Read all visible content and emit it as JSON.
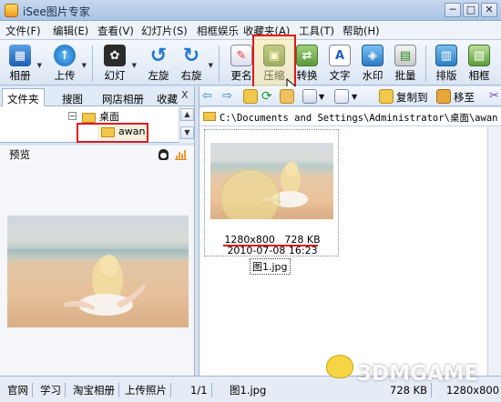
{
  "window": {
    "title": "iSee图片专家",
    "controls": [
      "─",
      "□",
      "✕"
    ]
  },
  "menu": [
    "文件(F)",
    "编辑(E)",
    "查看(V)",
    "幻灯片(S)",
    "相框娱乐",
    "收藏夹(A)",
    "工具(T)",
    "帮助(H)"
  ],
  "toolbar": {
    "album": "相册",
    "upload": "上传",
    "slideshow": "幻灯",
    "rotate_left": "左旋",
    "rotate_right": "右旋",
    "rename": "更名",
    "compress": "压缩",
    "convert": "转换",
    "text": "文字",
    "watermark": "水印",
    "batch": "批量",
    "layout": "排版",
    "frame": "相框"
  },
  "left_tabs": [
    "文件夹",
    "搜图",
    "网店相册",
    "收藏"
  ],
  "left_tab_close": "X",
  "tree": {
    "parent": "桌面",
    "child": "awan",
    "expander": "−"
  },
  "preview_label": "预览",
  "right_toolbar": {
    "copy_to": "复制到",
    "move_to": "移至"
  },
  "path": "C:\\Documents and Settings\\Administrator\\桌面\\awan",
  "thumbnail": {
    "dimensions": "1280x800",
    "size": "728 KB",
    "datetime": "2010-07-08 16:23",
    "filename": "图1.jpg"
  },
  "status": {
    "links": [
      "官网",
      "学习",
      "淘宝相册",
      "上传照片"
    ],
    "count": "1/1",
    "file": "图1.jpg",
    "size": "728 KB",
    "dims": "1280x800"
  },
  "watermark_logo": "3DMGAME",
  "colors": {
    "highlight_red": "#e3161c",
    "menu_bg": "#eef3fa",
    "toolbar_bg": "#dbe6f4",
    "folder_yellow": "#f2c84b"
  }
}
